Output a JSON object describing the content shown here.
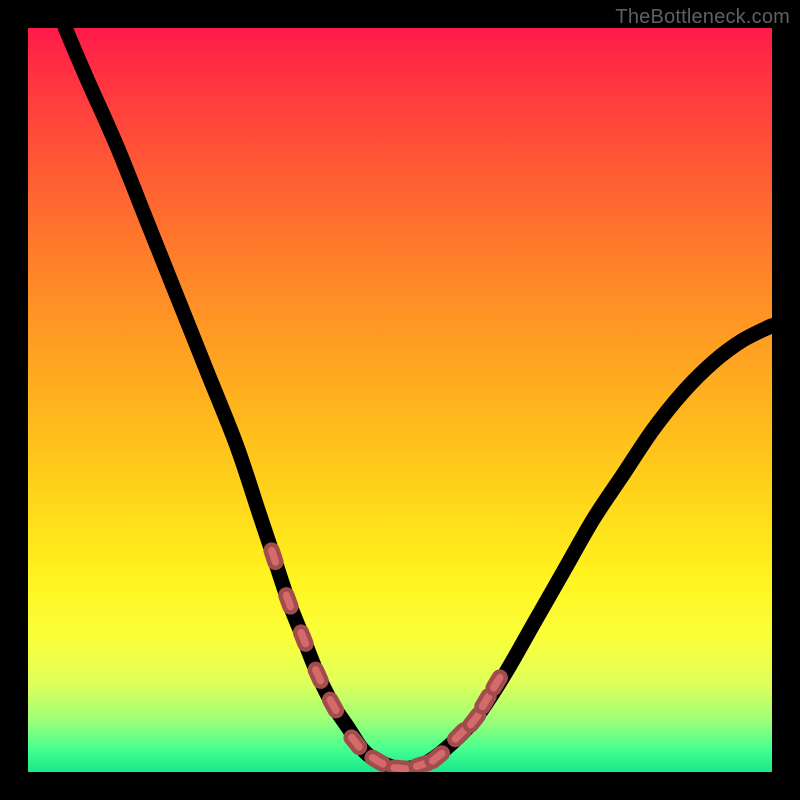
{
  "watermark": "TheBottleneck.com",
  "colors": {
    "background": "#000000",
    "gradient_top": "#ff1b49",
    "gradient_bottom": "#17e98a",
    "curve": "#000000",
    "marker_fill": "#d46a6a",
    "marker_stroke": "#a24d4d"
  },
  "chart_data": {
    "type": "line",
    "title": "",
    "xlabel": "",
    "ylabel": "",
    "xlim": [
      0,
      100
    ],
    "ylim": [
      0,
      100
    ],
    "note": "Axes unlabeled in source; values are percentage approximations read from pixel positions on a 0–100 scale.",
    "series": [
      {
        "name": "curve",
        "x": [
          5,
          8,
          12,
          16,
          20,
          24,
          28,
          31,
          33,
          35,
          37,
          39,
          41,
          43,
          45,
          47,
          50,
          53,
          56,
          60,
          64,
          68,
          72,
          76,
          80,
          84,
          88,
          92,
          96,
          100
        ],
        "y": [
          100,
          93,
          84,
          74,
          64,
          54,
          44,
          35,
          29,
          23,
          18,
          13,
          9,
          6,
          3,
          1.5,
          0.5,
          1,
          3,
          7,
          13,
          20,
          27,
          34,
          40,
          46,
          51,
          55,
          58,
          60
        ]
      }
    ],
    "markers": {
      "name": "highlighted-points",
      "x": [
        33,
        35,
        37,
        39,
        41,
        44,
        47,
        50,
        53,
        55,
        58,
        60,
        61.5,
        63
      ],
      "y": [
        29,
        23,
        18,
        13,
        9,
        4,
        1.5,
        0.5,
        1,
        2,
        5,
        7,
        9.5,
        12
      ]
    }
  }
}
